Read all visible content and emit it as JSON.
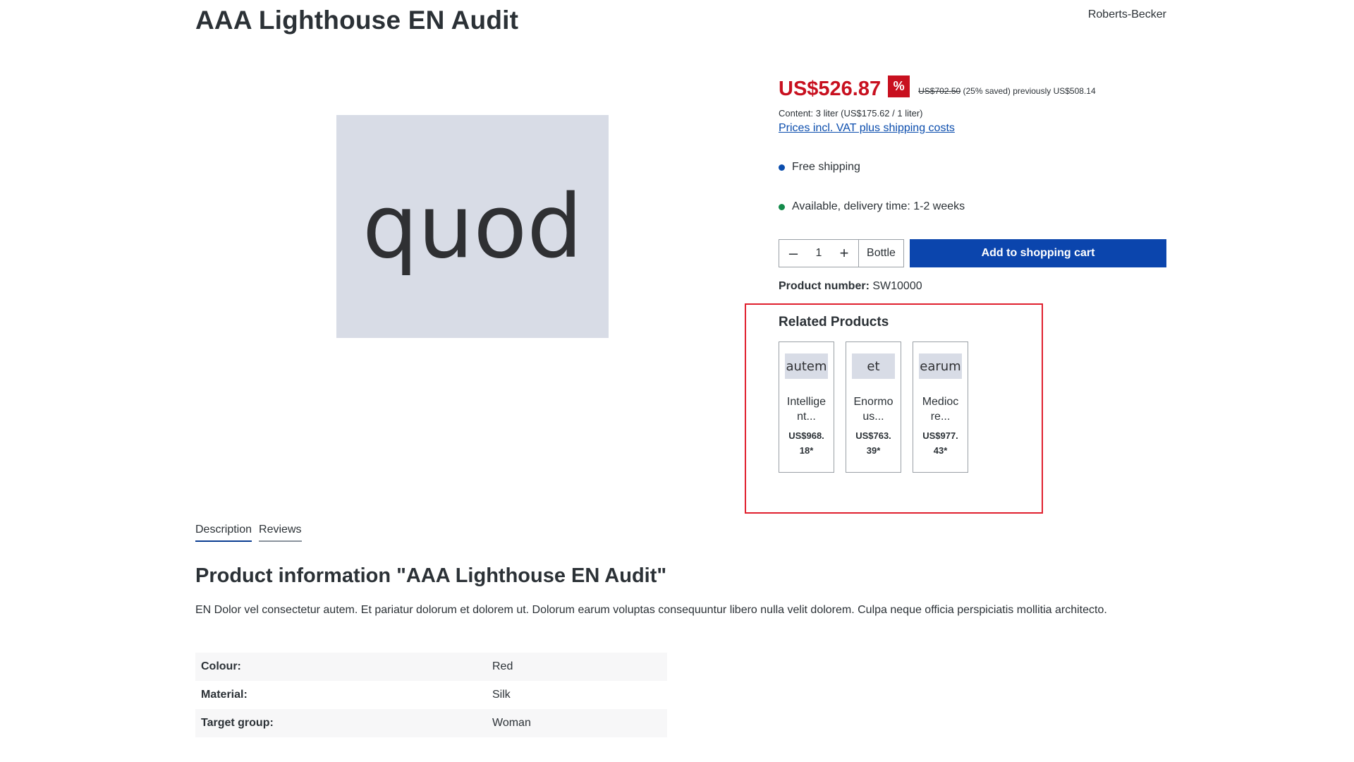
{
  "product": {
    "title": "AAA Lighthouse EN Audit",
    "manufacturer": "Roberts-Becker",
    "image_text": "quod"
  },
  "pricing": {
    "price": "US$526.87",
    "discount_badge": "%",
    "list_price": "US$702.50",
    "saved": "(25% saved)",
    "previously": "previously US$508.14",
    "content": "Content: 3 liter (US$175.62 / 1 liter)",
    "vat_link": "Prices incl. VAT plus shipping costs"
  },
  "status": {
    "shipping": "Free shipping",
    "availability": "Available, delivery time: 1-2 weeks"
  },
  "buy": {
    "quantity": "1",
    "minus": "–",
    "plus": "+",
    "unit": "Bottle",
    "add_to_cart": "Add to shopping cart"
  },
  "product_number": {
    "label": "Product number:",
    "value": "SW10000"
  },
  "related": {
    "title": "Related Products",
    "items": [
      {
        "image_text": "autem",
        "name": "Intellige nt...",
        "price": "US$968. 18*"
      },
      {
        "image_text": "et",
        "name": "Enormo us...",
        "price": "US$763. 39*"
      },
      {
        "image_text": "earum",
        "name": "Medioc re...",
        "price": "US$977. 43*"
      }
    ]
  },
  "tabs": [
    {
      "label": "Description"
    },
    {
      "label": "Reviews"
    }
  ],
  "info": {
    "title": "Product information \"AAA Lighthouse EN Audit\"",
    "description": "EN Dolor vel consectetur autem. Et pariatur dolorum et dolorem ut. Dolorum earum voluptas consequuntur libero nulla velit dolorem. Culpa neque officia perspiciatis mollitia architecto."
  },
  "properties": [
    {
      "key": "Colour:",
      "value": "Red"
    },
    {
      "key": "Material:",
      "value": "Silk"
    },
    {
      "key": "Target group:",
      "value": "Woman"
    }
  ],
  "colors": {
    "price_red": "#c8101f",
    "primary_blue": "#0b45ad",
    "highlight_border": "#e0202e",
    "placeholder_bg": "#d8dce6"
  }
}
